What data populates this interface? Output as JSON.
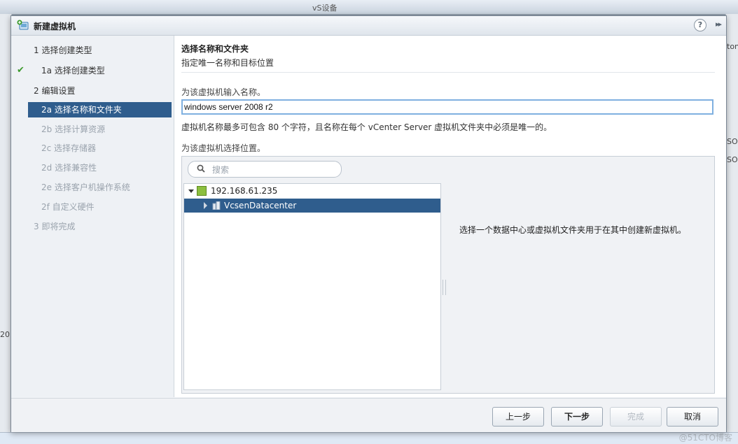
{
  "background": {
    "topbar_text": "vS设备",
    "left_text": "20",
    "right_texts": [
      "ton",
      "SO",
      "SO"
    ]
  },
  "dialog": {
    "title": "新建虚拟机",
    "help_glyph": "?",
    "expand_glyph": "▸▸"
  },
  "nav": {
    "items": [
      {
        "label": "1  选择创建类型",
        "state": "step"
      },
      {
        "label": "1a  选择创建类型",
        "state": "done"
      },
      {
        "label": "2  编辑设置",
        "state": "step"
      },
      {
        "label": "2a  选择名称和文件夹",
        "state": "active"
      },
      {
        "label": "2b  选择计算资源",
        "state": "dim"
      },
      {
        "label": "2c  选择存储器",
        "state": "dim"
      },
      {
        "label": "2d  选择兼容性",
        "state": "dim"
      },
      {
        "label": "2e  选择客户机操作系统",
        "state": "dim"
      },
      {
        "label": "2f  自定义硬件",
        "state": "dim"
      },
      {
        "label": "3  即将完成",
        "state": "dim"
      }
    ],
    "check_glyph": "✔"
  },
  "content": {
    "title": "选择名称和文件夹",
    "subtitle": "指定唯一名称和目标位置",
    "name_label": "为该虚拟机输入名称。",
    "name_value": "windows server 2008 r2",
    "name_hint": "虚拟机名称最多可包含 80 个字符，且名称在每个 vCenter Server 虚拟机文件夹中必须是唯一的。",
    "location_label": "为该虚拟机选择位置。",
    "search_placeholder": "搜索",
    "tree": [
      {
        "label": "192.168.61.235",
        "selected": false
      },
      {
        "label": "VcsenDatacenter",
        "selected": true
      }
    ],
    "right_message": "选择一个数据中心或虚拟机文件夹用于在其中创建新虚拟机。"
  },
  "footer": {
    "back": "上一步",
    "next": "下一步",
    "finish": "完成",
    "cancel": "取消"
  },
  "watermark": "@51CTO博客",
  "colors": {
    "selection": "#2f5d8d",
    "check": "#3c9a2d",
    "input_focus": "#7fb0e0"
  }
}
